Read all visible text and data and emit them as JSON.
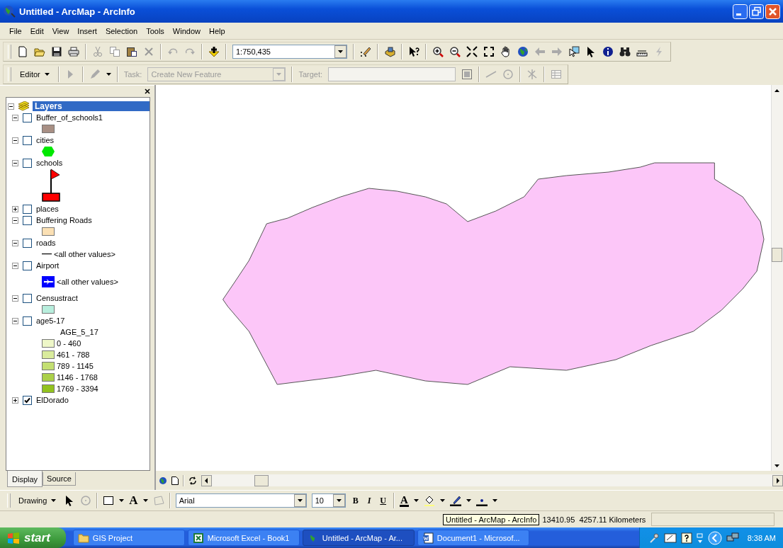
{
  "window": {
    "title": "Untitled - ArcMap - ArcInfo"
  },
  "menu": [
    "File",
    "Edit",
    "View",
    "Insert",
    "Selection",
    "Tools",
    "Window",
    "Help"
  ],
  "standard_toolbar": {
    "scale": "1:750,435"
  },
  "editor_toolbar": {
    "menu": "Editor",
    "task_label": "Task:",
    "task": "Create New Feature",
    "target_label": "Target:"
  },
  "toc": {
    "root": {
      "label": "Layers",
      "selected": true,
      "expanded": true
    },
    "layers": [
      {
        "name": "Buffer_of_schools1",
        "checked": false,
        "expanded": true,
        "legend": [
          {
            "kind": "fill",
            "color": "#a88f84"
          }
        ]
      },
      {
        "name": "cities",
        "checked": false,
        "expanded": true,
        "legend": [
          {
            "kind": "hexagon",
            "color": "#00e800"
          }
        ]
      },
      {
        "name": "schools",
        "checked": false,
        "expanded": true,
        "legend": [
          {
            "kind": "flag",
            "color": "#ff0000"
          }
        ]
      },
      {
        "name": "places",
        "checked": false,
        "expanded": false
      },
      {
        "name": "Buffering Roads",
        "checked": false,
        "expanded": true,
        "legend": [
          {
            "kind": "fill",
            "color": "#fbe0b4"
          }
        ]
      },
      {
        "name": "roads",
        "checked": false,
        "expanded": true,
        "legend": [
          {
            "kind": "line",
            "label": "<all other values>"
          }
        ]
      },
      {
        "name": "Airport",
        "checked": false,
        "expanded": true,
        "legend": [
          {
            "kind": "airplane",
            "color": "#0000ff",
            "label": "<all other values>"
          }
        ]
      },
      {
        "name": "Censustract",
        "checked": false,
        "expanded": true,
        "legend": [
          {
            "kind": "fill",
            "color": "#b8eedd"
          }
        ]
      },
      {
        "name": "age5-17",
        "checked": false,
        "expanded": true,
        "field": "AGE_5_17",
        "legend": [
          {
            "kind": "fill",
            "color": "#eef7c8",
            "label": "0 - 460"
          },
          {
            "kind": "fill",
            "color": "#d9eb9c",
            "label": "461 - 788"
          },
          {
            "kind": "fill",
            "color": "#c3df72",
            "label": "789 - 1145"
          },
          {
            "kind": "fill",
            "color": "#abd04a",
            "label": "1146 - 1768"
          },
          {
            "kind": "fill",
            "color": "#92c21e",
            "label": "1769 - 3394"
          }
        ]
      },
      {
        "name": "ElDorado",
        "checked": true,
        "expanded": false
      }
    ]
  },
  "toc_tabs": [
    {
      "label": "Display",
      "selected": true
    },
    {
      "label": "Source",
      "selected": false
    }
  ],
  "drawing_toolbar": {
    "menu": "Drawing",
    "text_tool": "A",
    "font": "Arial",
    "size": "10",
    "styles": [
      "B",
      "I",
      "U"
    ],
    "font_color_tool": "A"
  },
  "status_bar": {
    "tooltip": "Untitled - ArcMap - ArcInfo",
    "coordinates": "13410.95  4257.11 Kilometers"
  },
  "taskbar": {
    "start": "start",
    "tasks": [
      {
        "label": "GIS Project",
        "kind": "folder",
        "selected": false
      },
      {
        "label": "Microsoft Excel - Book1",
        "kind": "excel",
        "selected": false
      },
      {
        "label": "Untitled - ArcMap - Ar...",
        "kind": "arcmap",
        "selected": true
      },
      {
        "label": "Document1 - Microsof...",
        "kind": "word",
        "selected": false
      }
    ],
    "clock": "8:38 AM"
  }
}
